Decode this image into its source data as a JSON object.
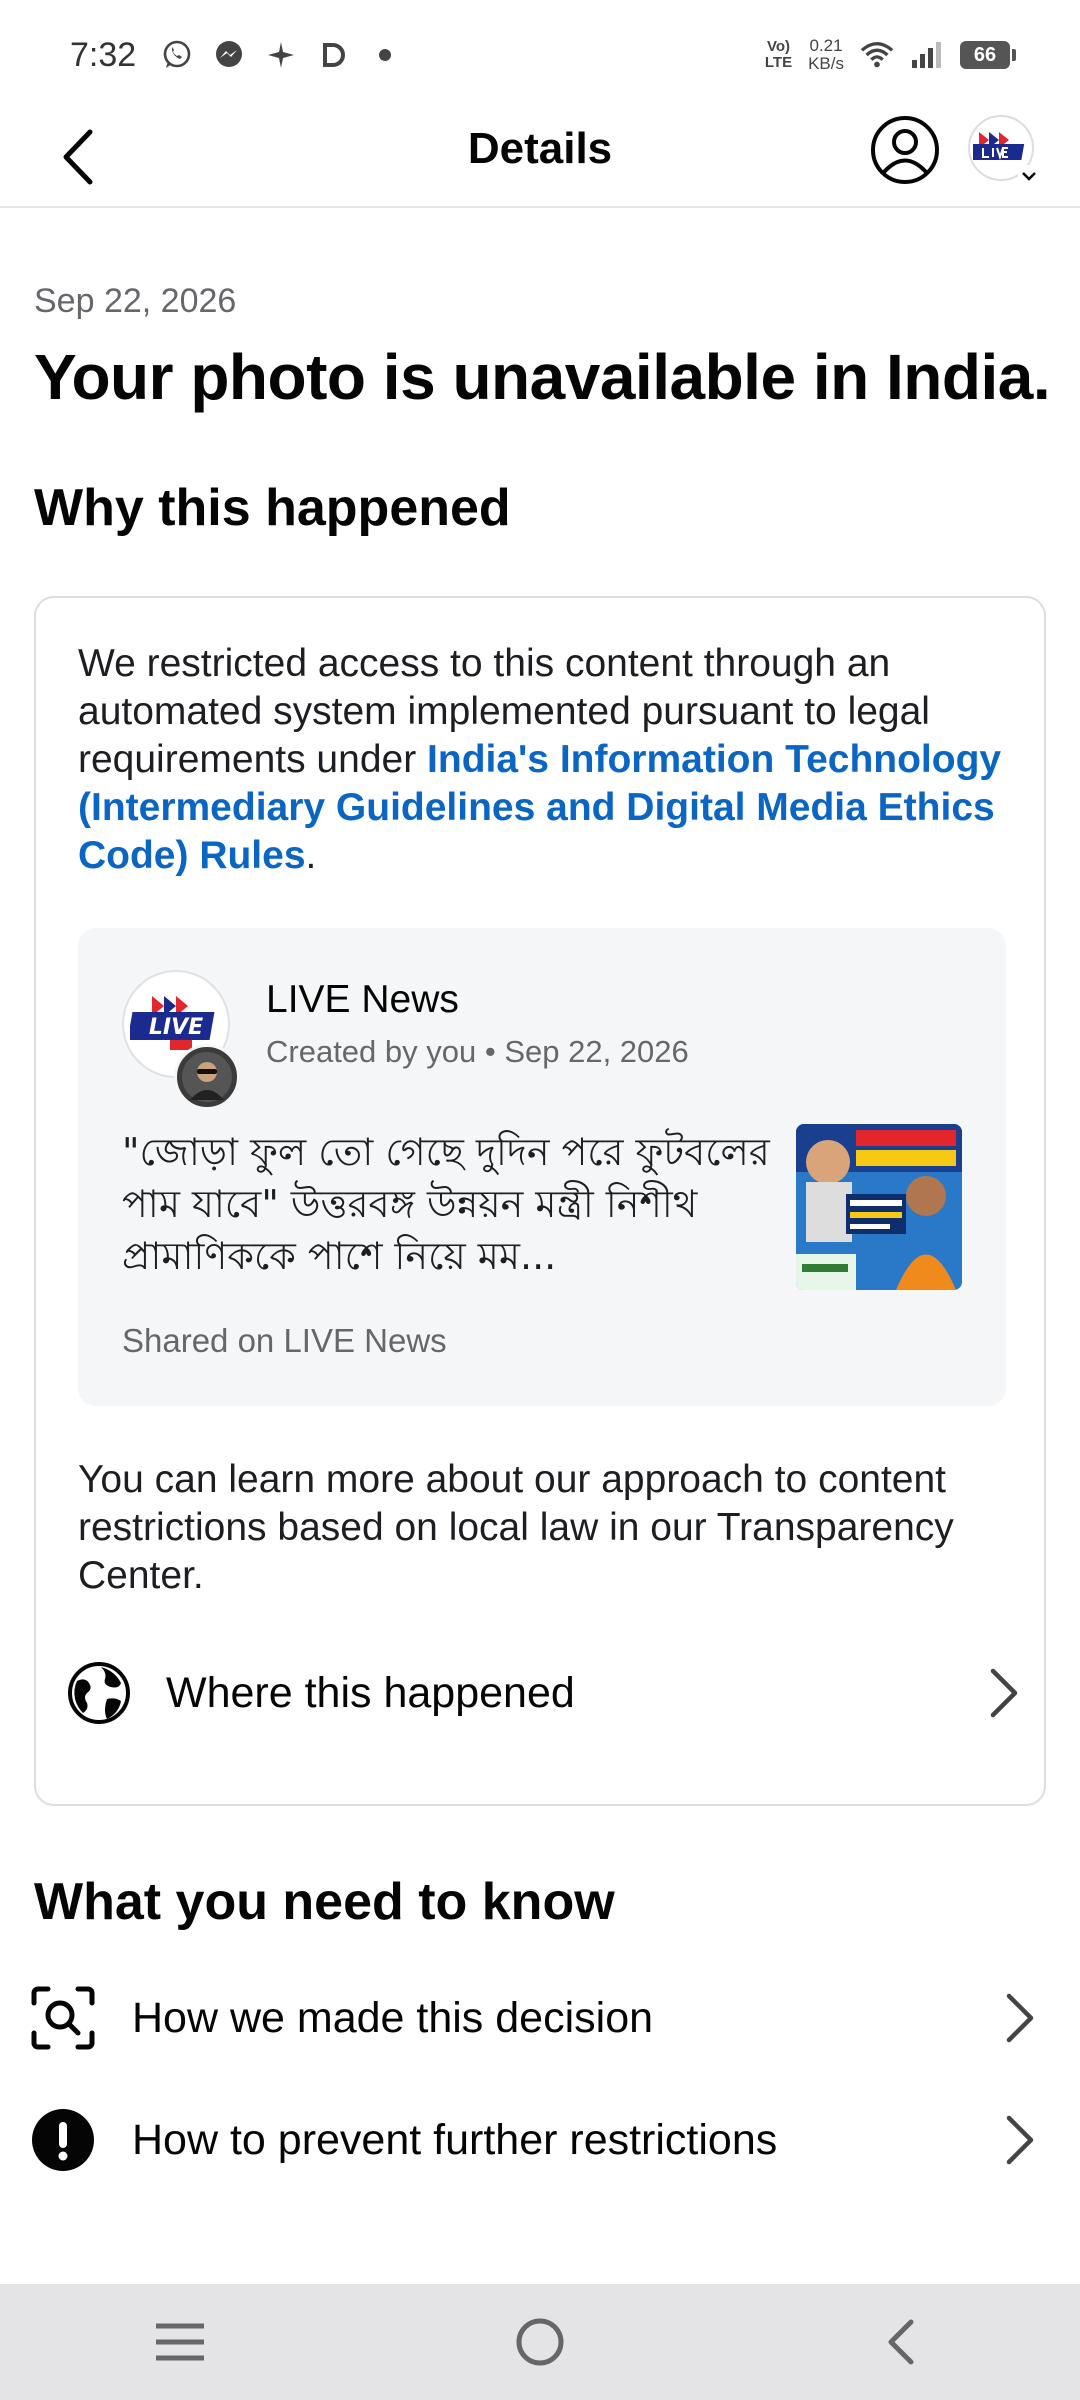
{
  "status_bar": {
    "time": "7:32",
    "volte_line1": "Vo)",
    "volte_line2": "LTE",
    "speed_value": "0.21",
    "speed_unit": "KB/s",
    "battery": "66"
  },
  "header": {
    "title": "Details"
  },
  "content": {
    "date": "Sep 22, 2026",
    "title": "Your photo is unavailable in India.",
    "why_heading": "Why this happened",
    "restriction_text_before": "We restricted access to this content through an automated system implemented pursuant to legal requirements under ",
    "restriction_link": "India's Information Technology (Intermediary Guidelines and Digital Media Ethics Code) Rules",
    "restriction_text_after": ".",
    "post": {
      "page_name": "LIVE News",
      "logo_text": "LIVE",
      "meta": "Created by you • Sep 22, 2026",
      "text": "\"জোড়া ফুল তো গেছে দুদিন পরে ফুটবলের পাম যাবে\" উত্তরবঙ্গ উন্নয়ন মন্ত্রী নিশীথ প্রামাণিককে পাশে নিয়ে মম...",
      "shared_on": "Shared on LIVE News"
    },
    "learn_more_text": "You can learn more about our approach to content restrictions based on local law in our Transparency Center.",
    "where_label": "Where this happened",
    "know_heading": "What you need to know",
    "decision_label": "How we made this decision",
    "prevent_label": "How to prevent further restrictions"
  },
  "colors": {
    "link": "#0a66c2",
    "text": "#050505",
    "secondary": "#65676b"
  }
}
